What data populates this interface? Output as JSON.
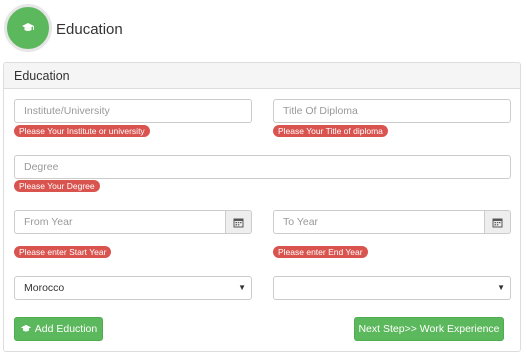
{
  "header": {
    "title": "Education",
    "icon": "graduation-cap-icon"
  },
  "panel": {
    "title": "Education"
  },
  "form": {
    "institute": {
      "placeholder": "Institute/University",
      "error": "Please Your Institute or university"
    },
    "diploma": {
      "placeholder": "Title Of Diploma",
      "error": "Please Your Title of diploma"
    },
    "degree": {
      "placeholder": "Degree",
      "error": "Please Your Degree"
    },
    "from_year": {
      "placeholder": "From Year",
      "error": "Please enter Start Year",
      "icon": "calendar-icon"
    },
    "to_year": {
      "placeholder": "To Year",
      "error": "Please enter End Year",
      "icon": "calendar-icon"
    },
    "country": {
      "value": "Morocco"
    },
    "second_select": {
      "value": ""
    }
  },
  "buttons": {
    "add": {
      "label": "Add Eduction",
      "icon": "graduation-cap-icon"
    },
    "next": {
      "label": "Next Step>> Work Experience"
    }
  },
  "colors": {
    "success": "#5cb85c",
    "danger": "#d9534f"
  }
}
